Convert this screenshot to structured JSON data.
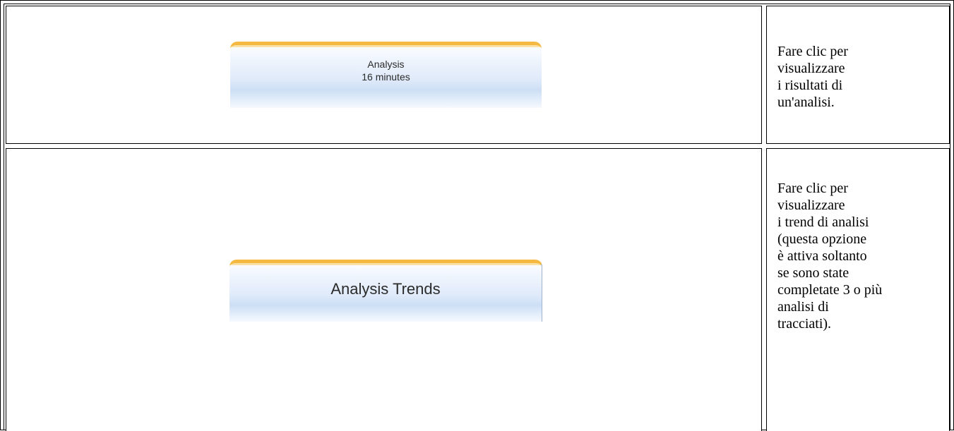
{
  "rows": [
    {
      "button": {
        "line1": "Analysis",
        "line2": "16 minutes"
      },
      "description": [
        "Fare clic per",
        "visualizzare",
        "i risultati di",
        "un'analisi."
      ]
    },
    {
      "button": {
        "label": "Analysis Trends"
      },
      "description": [
        "Fare clic per",
        "visualizzare",
        "i trend di analisi",
        "(questa opzione",
        "è attiva soltanto",
        "se sono state",
        "completate 3 o più",
        "analisi di",
        "tracciati)."
      ]
    }
  ],
  "colors": {
    "tab_accent": "#f5b942",
    "button_gradient_top": "#fcfdff",
    "button_gradient_mid": "#cddff5",
    "border": "#000000"
  }
}
